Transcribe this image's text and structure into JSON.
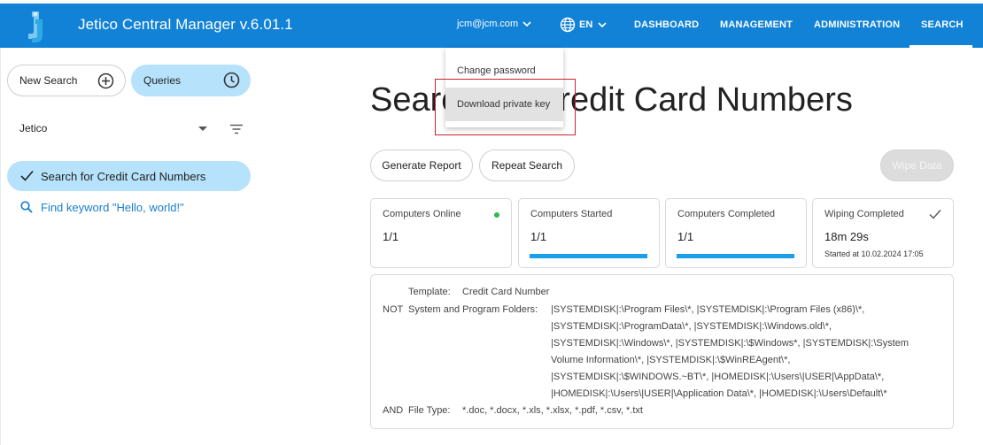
{
  "app": {
    "title": "Jetico Central Manager  v.6.01.1",
    "user": "jcm@jcm.com",
    "language": "EN",
    "nav": [
      "DASHBOARD",
      "MANAGEMENT",
      "ADMINISTRATION",
      "SEARCH"
    ],
    "active_nav": "SEARCH"
  },
  "user_menu": {
    "items": [
      "Change password",
      "Download private key"
    ],
    "hovered": "Download private key"
  },
  "sidebar": {
    "new_search": "New Search",
    "queries": "Queries",
    "organization": "Jetico",
    "query_items": [
      {
        "label": "Search for Credit Card Numbers",
        "icon": "check-icon",
        "active": true
      },
      {
        "label": "Find keyword \"Hello, world!\"",
        "icon": "search-icon",
        "active": false
      }
    ]
  },
  "main": {
    "title": "Search for Credit Card Numbers",
    "buttons": {
      "generate_report": "Generate Report",
      "repeat_search": "Repeat Search",
      "wipe_data": "Wipe Data"
    },
    "cards": [
      {
        "label": "Computers Online",
        "value": "1/1",
        "status": "online"
      },
      {
        "label": "Computers Started",
        "value": "1/1",
        "progress": 1.0
      },
      {
        "label": "Computers Completed",
        "value": "1/1",
        "progress": 1.0
      },
      {
        "label": "Wiping Completed",
        "value": "18m 29s",
        "sub": "Started at 10.02.2024 17:05"
      }
    ],
    "details": {
      "template_label": "Template:",
      "template_value": "Credit Card Number",
      "not_prefix": "NOT",
      "folders_label": "System and Program Folders:",
      "folders_lines": [
        "|SYSTEMDISK|:\\Program Files\\*, |SYSTEMDISK|:\\Program Files (x86)\\*,",
        "|SYSTEMDISK|:\\ProgramData\\*, |SYSTEMDISK|:\\Windows.old\\*,",
        "|SYSTEMDISK|:\\Windows\\*, |SYSTEMDISK|:\\$Windows*, |SYSTEMDISK|:\\System",
        "Volume Information\\*, |SYSTEMDISK|:\\$WinREAgent\\*,",
        "|SYSTEMDISK|:\\$WINDOWS.~BT\\*, |HOMEDISK|:\\Users\\|USER|\\AppData\\*,",
        "|HOMEDISK|:\\Users\\|USER|\\Application Data\\*, |HOMEDISK|:\\Users\\Default\\*"
      ],
      "and_prefix": "AND",
      "filetype_label": "File Type:",
      "filetype_value": "*.doc, *.docx, *.xls, *.xlsx, *.pdf, *.csv, *.txt"
    }
  },
  "colors": {
    "topbar": "#1182d6",
    "accent_light": "#b6e2fb",
    "progress": "#1ba0e8",
    "online": "#2fb84a",
    "highlight": "#c4262e"
  }
}
